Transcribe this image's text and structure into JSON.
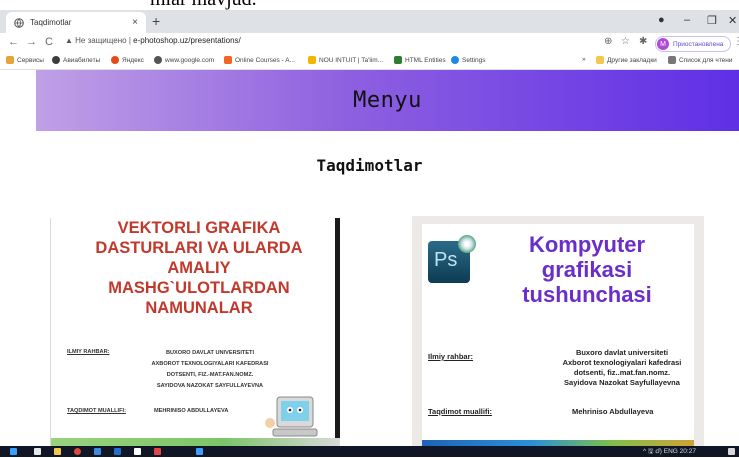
{
  "caption_fragment": "mlar mavjud.",
  "browser": {
    "tab_title": "Taqdimotlar",
    "tab_close": "×",
    "new_tab": "+",
    "window_controls": [
      "●",
      "–",
      "❐",
      "✕"
    ],
    "address": {
      "security_label": "Не защищено",
      "url": "e-photoshop.uz/presentations/",
      "separator": "|"
    },
    "profile": {
      "initial": "M",
      "label": "Приостановлена"
    },
    "bookmarks": [
      {
        "label": "Сервисы",
        "color": "#e8a33a"
      },
      {
        "label": "Авиабилеты",
        "color": "#3d3d3d"
      },
      {
        "label": "Яндекс",
        "color": "#e64a19"
      },
      {
        "label": "www.google.com",
        "color": "#555555"
      },
      {
        "label": "Online Courses - A...",
        "color": "#f26522"
      },
      {
        "label": "NOU INTUIT | Ta'lim...",
        "color": "#f2b600"
      },
      {
        "label": "HTML Entities",
        "color": "#2e7d32"
      },
      {
        "label": "Settings",
        "color": "#1e88e5"
      }
    ],
    "bookmarks_right": [
      {
        "label": "»",
        "color": "#ffffff"
      },
      {
        "label": "Другие закладки",
        "color": "#f2c94c"
      },
      {
        "label": "Список для чтени",
        "color": "#777777"
      }
    ]
  },
  "page": {
    "menu_label": "Menyu",
    "heading": "Taqdimotlar",
    "cards": [
      {
        "title_lines": [
          "VEKTORLI GRAFIKA",
          "DASTURLARI VA ULARDA",
          "AMALIY",
          "MASHG`ULOTLARDAN",
          "NAMUNALAR"
        ],
        "supervisor_label": "ILMIY RAHBAR:",
        "supervisor_lines": [
          "BUXORO DAVLAT UNIVERSITETI",
          "AXBOROT TEXNOLOGIYALARI KAFEDRASI",
          "DOTSENTI, FIZ.-MAT.FAN.NOMZ.",
          "SAYIDOVA NAZOKAT SAYFULLAYEVNA"
        ],
        "author_label": "TAQDIMOT MUALLIFI:",
        "author": "MEHRINISO ABDULLAYEVA"
      },
      {
        "logo": "Ps",
        "title_lines": [
          "Kompyuter",
          "grafikasi",
          "tushunchasi"
        ],
        "supervisor_label": "Ilmiy rahbar:",
        "supervisor_lines": [
          "Buxoro davlat universiteti",
          "Axborot texnologiyalari kafedrasi",
          "dotsenti, fiz..mat.fan.nomz.",
          "Sayidova Nazokat Sayfullayevna"
        ],
        "author_label": "Taqdimot muallifi:",
        "author": "Mehriniso Abdullayeva"
      }
    ]
  },
  "taskbar": {
    "tray_text": "^ 🖫 ⅆ) ENG 20:27",
    "icon_colors": [
      "#3aa0ff",
      "#e7e7e7",
      "#f2c94c",
      "#d94b3b",
      "#3d8be0",
      "#1f6fd1",
      "#ffffff",
      "#e04646",
      "#3aa0ff"
    ]
  }
}
